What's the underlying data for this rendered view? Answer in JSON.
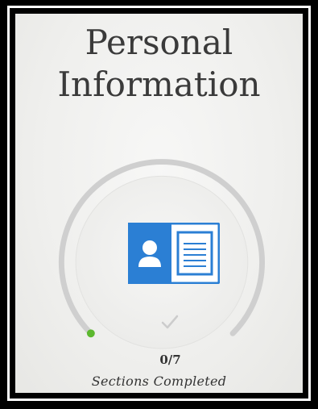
{
  "card": {
    "title_line1": "Personal",
    "title_line2": "Information",
    "icon": "id-card-icon",
    "status_icon": "checkmark-icon",
    "progress_text": "0/7",
    "progress_label": "Sections Completed",
    "completed": 0,
    "total": 7
  },
  "colors": {
    "accent": "#2b7fd4",
    "ring": "#cfcfcf",
    "ring_start": "#5cb82e",
    "check": "#cccccc",
    "title": "#3a3a3a"
  }
}
